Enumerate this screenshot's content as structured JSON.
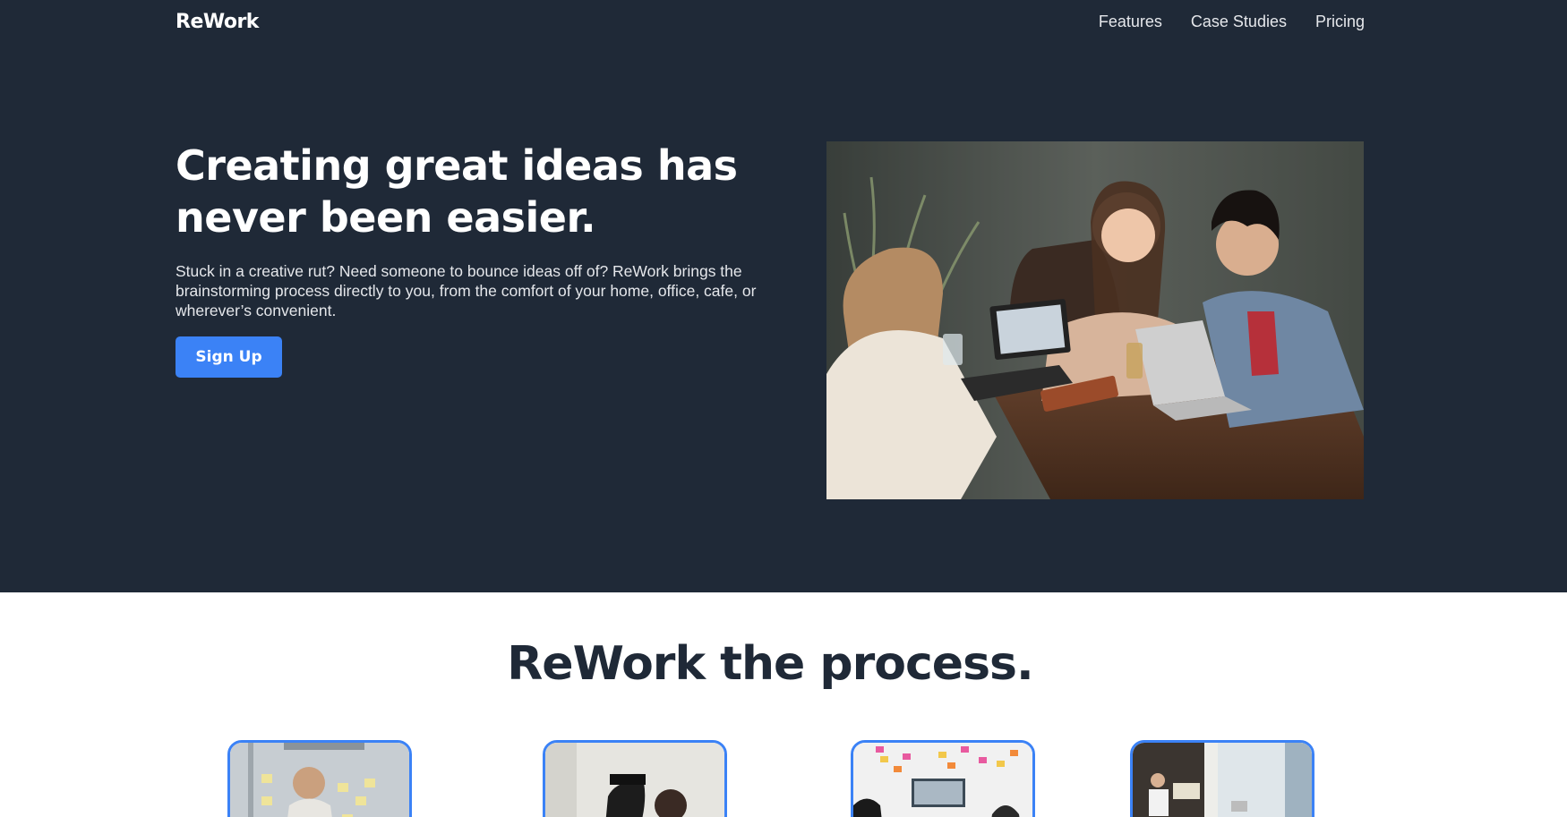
{
  "brand": {
    "logo": "ReWork"
  },
  "nav": {
    "items": [
      {
        "label": "Features"
      },
      {
        "label": "Case Studies"
      },
      {
        "label": "Pricing"
      }
    ]
  },
  "hero": {
    "title": "Creating great ideas has never been easier.",
    "description": "Stuck in a creative rut? Need someone to bounce ideas off of? ReWork brings the brainstorming process directly to you, from the comfort of your home, office, cafe, or wherever’s convenient.",
    "cta_label": "Sign Up",
    "image_subject": "friends-laughing-around-laptops"
  },
  "process": {
    "title": "ReWork the process."
  },
  "colors": {
    "hero_bg": "#1f2937",
    "accent": "#3b82f6",
    "heading_dark": "#1f2937"
  }
}
